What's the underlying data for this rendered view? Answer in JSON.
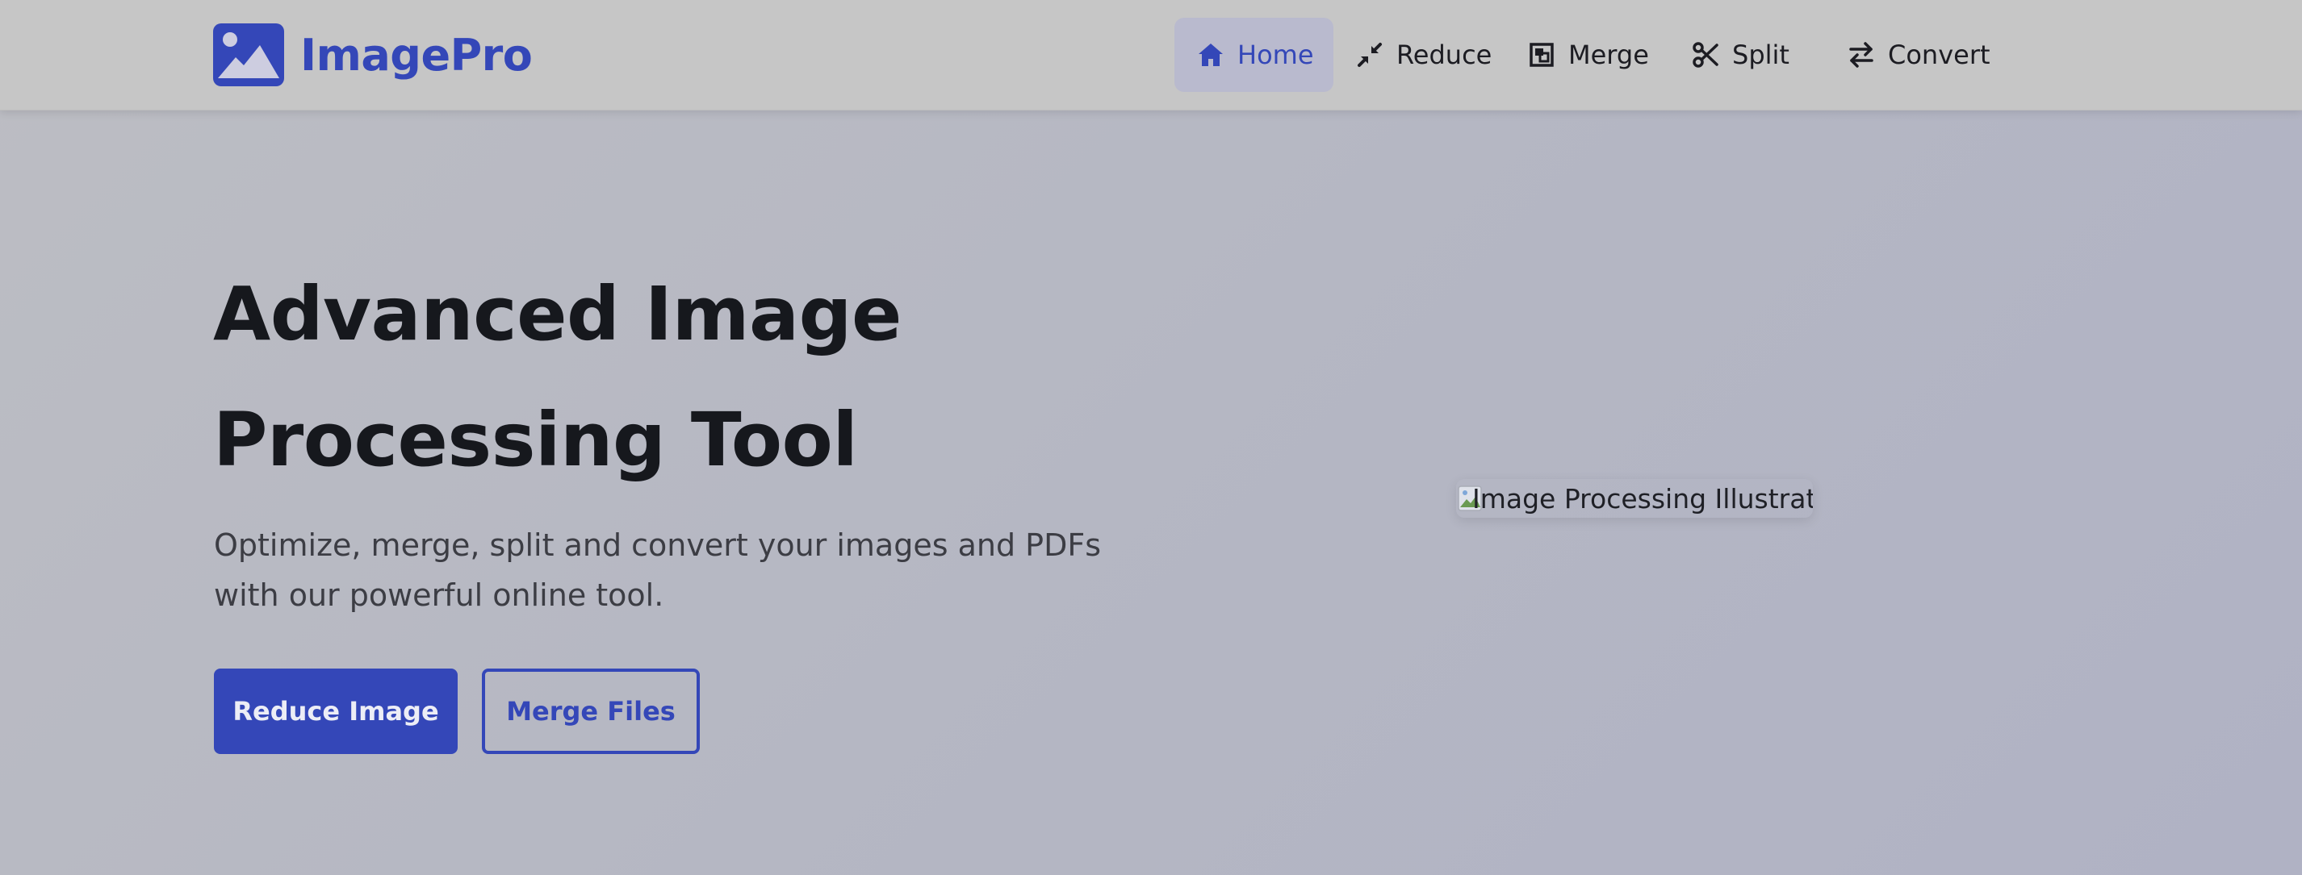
{
  "brand": {
    "name": "ImagePro",
    "logo_icon": "image-icon",
    "color": "#3447b8"
  },
  "nav": {
    "items": [
      {
        "label": "Home",
        "icon": "home-icon",
        "active": true
      },
      {
        "label": "Reduce",
        "icon": "compress-icon",
        "active": false
      },
      {
        "label": "Merge",
        "icon": "object-group-icon",
        "active": false
      },
      {
        "label": "Split",
        "icon": "scissors-icon",
        "active": false
      },
      {
        "label": "Convert",
        "icon": "exchange-icon",
        "active": false
      }
    ]
  },
  "hero": {
    "title_line1": "Advanced Image",
    "title_line2": "Processing Tool",
    "subtitle": "Optimize, merge, split and convert your images and PDFs with our powerful online tool.",
    "primary_button": "Reduce Image",
    "secondary_button": "Merge Files",
    "image_alt": "Image Processing Illustration"
  },
  "colors": {
    "accent": "#3447b8",
    "heading": "#16181d",
    "body_text": "#3c3d44",
    "navbar_bg": "#c6c6c6"
  }
}
